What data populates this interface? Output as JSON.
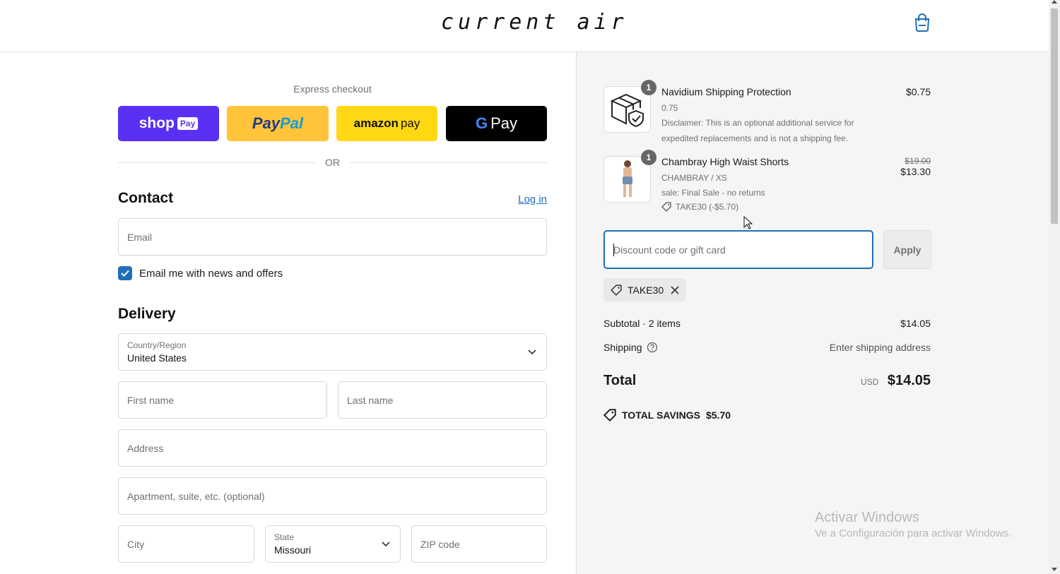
{
  "header": {
    "logo": "current air",
    "cart_icon": "shopping-bag-icon"
  },
  "express": {
    "title": "Express checkout",
    "shoppay_label": "shop",
    "shoppay_badge": "Pay",
    "paypal_label_1": "Pay",
    "paypal_label_2": "Pal",
    "amazon_label_1": "amazon",
    "amazon_label_2": "pay",
    "gpay_label_1": "G",
    "gpay_label_2": "Pay",
    "or": "OR"
  },
  "contact": {
    "title": "Contact",
    "login": "Log in",
    "email_placeholder": "Email",
    "newsletter_label": "Email me with news and offers",
    "newsletter_checked": true
  },
  "delivery": {
    "title": "Delivery",
    "country_label": "Country/Region",
    "country_value": "United States",
    "first_name": "First name",
    "last_name": "Last name",
    "address": "Address",
    "apartment": "Apartment, suite, etc. (optional)",
    "city": "City",
    "state_label": "State",
    "state_value": "Missouri",
    "zip": "ZIP code"
  },
  "order": {
    "items": [
      {
        "qty": "1",
        "name": "Navidium Shipping Protection",
        "variant": "0.75",
        "note1": "Disclaimer: This is an optional additional service for",
        "note2": "expedited replacements and is not a shipping fee.",
        "price": "$0.75"
      },
      {
        "qty": "1",
        "name": "Chambray High Waist Shorts",
        "variant": "CHAMBRAY / XS",
        "note1": "sale: Final Sale - no returns",
        "discount": "TAKE30 (-$5.70)",
        "original_price": "$19.00",
        "price": "$13.30"
      }
    ],
    "discount_placeholder": "Discount code or gift card",
    "apply_label": "Apply",
    "applied_code": "TAKE30",
    "subtotal_label": "Subtotal · 2 items",
    "subtotal_value": "$14.05",
    "shipping_label": "Shipping",
    "shipping_value": "Enter shipping address",
    "total_label": "Total",
    "total_currency": "USD",
    "total_value": "$14.05",
    "savings_label": "TOTAL SAVINGS",
    "savings_value": "$5.70"
  },
  "watermark": {
    "line1": "Activar Windows",
    "line2": "Ve a Configuración para activar Windows."
  },
  "colors": {
    "accent": "#1f6fb5",
    "shoppay": "#5a31f4",
    "paypal": "#ffc439",
    "amazon": "#ffd814",
    "gpay": "#000000"
  }
}
